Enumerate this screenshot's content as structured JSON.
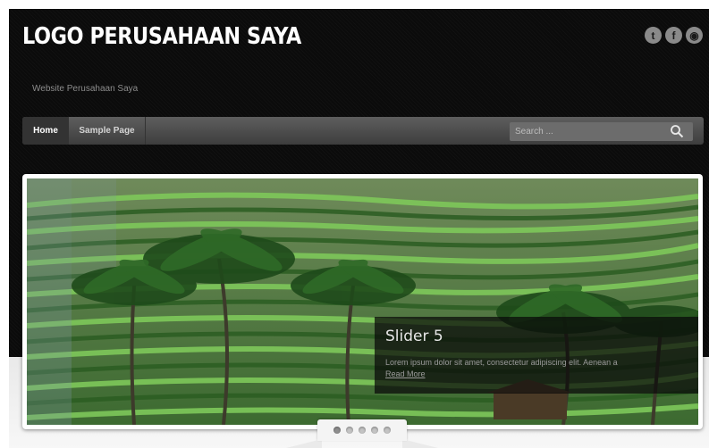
{
  "header": {
    "logo_text": "LOGO PERUSAHAAN SAYA",
    "tagline": "Website Perusahaan Saya",
    "social_icons": [
      "twitter-icon",
      "facebook-icon",
      "rss-icon"
    ],
    "social_glyphs": [
      "t",
      "f",
      "◉"
    ]
  },
  "nav": {
    "items": [
      {
        "label": "Home",
        "active": true
      },
      {
        "label": "Sample Page",
        "active": false
      }
    ],
    "search_placeholder": "Search ..."
  },
  "slider": {
    "caption_title": "Slider 5",
    "caption_text": "Lorem ipsum dolor sit amet, consectetur adipiscing elit. Aenean a",
    "read_more": "Read More",
    "dot_count": 5,
    "active_dot": 1
  },
  "colors": {
    "header_bg": "#0b0b0b",
    "nav_bg": "#4d4d4d",
    "caption_bg": "#080808",
    "field_green": "#3f9a33"
  }
}
